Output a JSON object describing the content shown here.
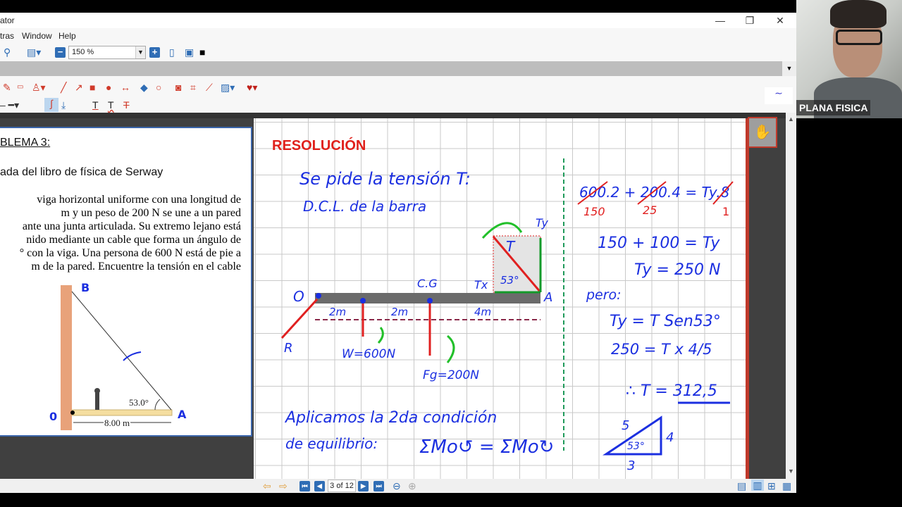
{
  "window": {
    "title": "ator",
    "minimize": "—",
    "restore": "❐",
    "close": "✕"
  },
  "menu": [
    "tras",
    "Window",
    "Help"
  ],
  "toolbar": {
    "zoom": "150 %",
    "zoom_out": "−",
    "zoom_in": "+"
  },
  "navigation": {
    "page": "3 of 12"
  },
  "webcam": {
    "name": "PLANA FISICA"
  },
  "problem": {
    "title": "BLEMA 3:",
    "subtitle": "ada del libro de física de Serway",
    "lines": [
      "viga horizontal uniforme con una longitud de",
      "m y un peso de 200 N se une a un pared",
      "ante una junta articulada. Su extremo lejano está",
      "nido mediante un cable que forma un ángulo de",
      "° con la viga. Una persona de 600 N está de pie a",
      "m de la pared. Encuentre la tensión en el cable"
    ],
    "figure": {
      "B": "B",
      "O": "0",
      "A": "A",
      "angle": "53.0°",
      "length": "8.00 m"
    }
  },
  "resolution": {
    "heading": "RESOLUCIÓN",
    "line1": "Se pide la tensión T:",
    "line2": "D.C.L. de la barra",
    "diagram": {
      "O": "O",
      "A": "A",
      "CG": "C.G",
      "Tx": "Tx",
      "Ty": "Ty",
      "T": "T",
      "angle": "53°",
      "R": "R",
      "d1": "2m",
      "d2": "2m",
      "d3": "4m",
      "W": "W=600N",
      "Fg": "Fg=200N"
    },
    "line3": "Aplicamos la 2da condición",
    "line4": "de equilibrio:",
    "equation": "ΣMo↺ = ΣMo↻"
  },
  "calc": {
    "eq1": "600.2 + 200.4 = Ty.8",
    "r1": "150",
    "r2": "25",
    "r3": "1",
    "eq2": "150 + 100 = Ty",
    "eq3": "Ty = 250 N",
    "pero": "pero:",
    "eq4": "Ty = T Sen53°",
    "eq5": "250 = T x 4/5",
    "eq6": "∴ T = 312,5",
    "tri": {
      "hyp": "5",
      "opp": "4",
      "adj": "3",
      "angle": "53°"
    }
  }
}
